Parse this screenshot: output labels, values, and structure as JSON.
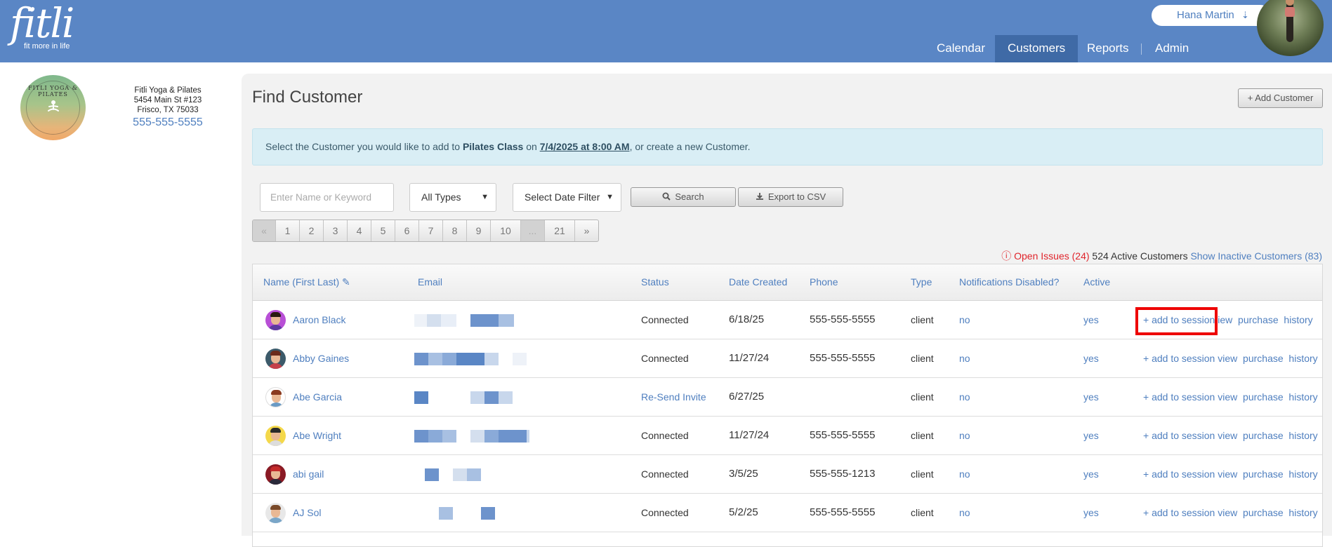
{
  "header": {
    "logo_text": "fitli",
    "logo_tagline": "fit more in life",
    "user_name": "Hana Martin",
    "nav": [
      {
        "label": "Calendar"
      },
      {
        "label": "Customers",
        "active": true
      },
      {
        "label": "Reports"
      },
      {
        "label": "Admin"
      }
    ]
  },
  "studio": {
    "logo_text": "FITLI YOGA & PILATES",
    "name": "Fitli Yoga & Pilates",
    "address1": "5454 Main St #123",
    "address2": "Frisco, TX 75033",
    "phone": "555-555-5555"
  },
  "main": {
    "title": "Find Customer",
    "add_customer_label": "+ Add Customer",
    "banner": {
      "prefix": "Select the Customer you would like to add to ",
      "class_name": "Pilates Class",
      "mid": " on ",
      "datetime": "7/4/2025 at 8:00 AM",
      "suffix": ", or create a new Customer."
    },
    "search_placeholder": "Enter Name or Keyword",
    "type_select": "All Types",
    "date_select": "Select Date Filter",
    "search_label": "Search",
    "export_label": "Export to CSV",
    "pager": [
      "«",
      "1",
      "2",
      "3",
      "4",
      "5",
      "6",
      "7",
      "8",
      "9",
      "10",
      "...",
      "21",
      "»"
    ],
    "stats": {
      "open_issues": "Open Issues (24)",
      "active_customers": "524 Active Customers",
      "show_inactive": "Show Inactive Customers (83)"
    },
    "columns": {
      "name": "Name (First Last)",
      "email": "Email",
      "status": "Status",
      "date_created": "Date Created",
      "phone": "Phone",
      "type": "Type",
      "notifications": "Notifications Disabled?",
      "active": "Active"
    },
    "actions": {
      "add_to_session": "+ add to session",
      "view": "view",
      "purchase": "purchase",
      "history": "history"
    },
    "rows": [
      {
        "name": "Aaron Black",
        "status": "Connected",
        "date": "6/18/25",
        "phone": "555-555-5555",
        "type": "client",
        "notif": "no",
        "active": "yes",
        "avatar_bg": "#b84fd6",
        "hair": "#2a1a10",
        "shirt": "#5c3aa0",
        "view_partial": "iew"
      },
      {
        "name": "Abby Gaines",
        "status": "Connected",
        "date": "11/27/24",
        "phone": "555-555-5555",
        "type": "client",
        "notif": "no",
        "active": "yes",
        "avatar_bg": "#3c5a6a",
        "hair": "#6a2a1a",
        "shirt": "#c5404a"
      },
      {
        "name": "Abe Garcia",
        "status": "Re-Send Invite",
        "date": "6/27/25",
        "phone": "",
        "type": "client",
        "notif": "no",
        "active": "yes",
        "avatar_bg": "#ffffff",
        "hair": "#8a3a20",
        "shirt": "#6a9ac4"
      },
      {
        "name": "Abe Wright",
        "status": "Connected",
        "date": "11/27/24",
        "phone": "555-555-5555",
        "type": "client",
        "notif": "no",
        "active": "yes",
        "avatar_bg": "#f4d84a",
        "hair": "#2a2a2a",
        "shirt": "#dcdcdc"
      },
      {
        "name": "abi gail",
        "status": "Connected",
        "date": "3/5/25",
        "phone": "555-555-1213",
        "type": "client",
        "notif": "no",
        "active": "yes",
        "avatar_bg": "#8a1a24",
        "hair": "#c42a2a",
        "shirt": "#2a2a3a"
      },
      {
        "name": "AJ Sol",
        "status": "Connected",
        "date": "5/2/25",
        "phone": "555-555-5555",
        "type": "client",
        "notif": "no",
        "active": "yes",
        "avatar_bg": "#e8e8e8",
        "hair": "#7a4a2a",
        "shirt": "#7aa6c8"
      }
    ]
  }
}
